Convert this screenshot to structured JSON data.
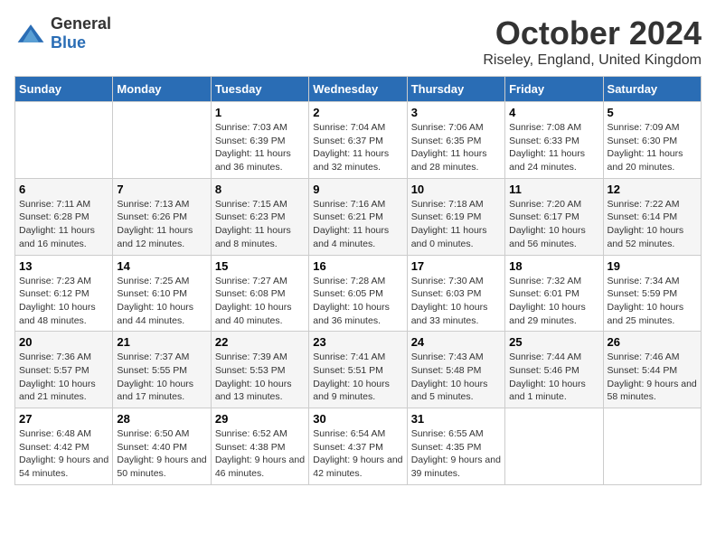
{
  "header": {
    "logo": {
      "general": "General",
      "blue": "Blue"
    },
    "month_title": "October 2024",
    "location": "Riseley, England, United Kingdom"
  },
  "weekdays": [
    "Sunday",
    "Monday",
    "Tuesday",
    "Wednesday",
    "Thursday",
    "Friday",
    "Saturday"
  ],
  "weeks": [
    [
      {
        "day": "",
        "sunrise": "",
        "sunset": "",
        "daylight": ""
      },
      {
        "day": "",
        "sunrise": "",
        "sunset": "",
        "daylight": ""
      },
      {
        "day": "1",
        "sunrise": "Sunrise: 7:03 AM",
        "sunset": "Sunset: 6:39 PM",
        "daylight": "Daylight: 11 hours and 36 minutes."
      },
      {
        "day": "2",
        "sunrise": "Sunrise: 7:04 AM",
        "sunset": "Sunset: 6:37 PM",
        "daylight": "Daylight: 11 hours and 32 minutes."
      },
      {
        "day": "3",
        "sunrise": "Sunrise: 7:06 AM",
        "sunset": "Sunset: 6:35 PM",
        "daylight": "Daylight: 11 hours and 28 minutes."
      },
      {
        "day": "4",
        "sunrise": "Sunrise: 7:08 AM",
        "sunset": "Sunset: 6:33 PM",
        "daylight": "Daylight: 11 hours and 24 minutes."
      },
      {
        "day": "5",
        "sunrise": "Sunrise: 7:09 AM",
        "sunset": "Sunset: 6:30 PM",
        "daylight": "Daylight: 11 hours and 20 minutes."
      }
    ],
    [
      {
        "day": "6",
        "sunrise": "Sunrise: 7:11 AM",
        "sunset": "Sunset: 6:28 PM",
        "daylight": "Daylight: 11 hours and 16 minutes."
      },
      {
        "day": "7",
        "sunrise": "Sunrise: 7:13 AM",
        "sunset": "Sunset: 6:26 PM",
        "daylight": "Daylight: 11 hours and 12 minutes."
      },
      {
        "day": "8",
        "sunrise": "Sunrise: 7:15 AM",
        "sunset": "Sunset: 6:23 PM",
        "daylight": "Daylight: 11 hours and 8 minutes."
      },
      {
        "day": "9",
        "sunrise": "Sunrise: 7:16 AM",
        "sunset": "Sunset: 6:21 PM",
        "daylight": "Daylight: 11 hours and 4 minutes."
      },
      {
        "day": "10",
        "sunrise": "Sunrise: 7:18 AM",
        "sunset": "Sunset: 6:19 PM",
        "daylight": "Daylight: 11 hours and 0 minutes."
      },
      {
        "day": "11",
        "sunrise": "Sunrise: 7:20 AM",
        "sunset": "Sunset: 6:17 PM",
        "daylight": "Daylight: 10 hours and 56 minutes."
      },
      {
        "day": "12",
        "sunrise": "Sunrise: 7:22 AM",
        "sunset": "Sunset: 6:14 PM",
        "daylight": "Daylight: 10 hours and 52 minutes."
      }
    ],
    [
      {
        "day": "13",
        "sunrise": "Sunrise: 7:23 AM",
        "sunset": "Sunset: 6:12 PM",
        "daylight": "Daylight: 10 hours and 48 minutes."
      },
      {
        "day": "14",
        "sunrise": "Sunrise: 7:25 AM",
        "sunset": "Sunset: 6:10 PM",
        "daylight": "Daylight: 10 hours and 44 minutes."
      },
      {
        "day": "15",
        "sunrise": "Sunrise: 7:27 AM",
        "sunset": "Sunset: 6:08 PM",
        "daylight": "Daylight: 10 hours and 40 minutes."
      },
      {
        "day": "16",
        "sunrise": "Sunrise: 7:28 AM",
        "sunset": "Sunset: 6:05 PM",
        "daylight": "Daylight: 10 hours and 36 minutes."
      },
      {
        "day": "17",
        "sunrise": "Sunrise: 7:30 AM",
        "sunset": "Sunset: 6:03 PM",
        "daylight": "Daylight: 10 hours and 33 minutes."
      },
      {
        "day": "18",
        "sunrise": "Sunrise: 7:32 AM",
        "sunset": "Sunset: 6:01 PM",
        "daylight": "Daylight: 10 hours and 29 minutes."
      },
      {
        "day": "19",
        "sunrise": "Sunrise: 7:34 AM",
        "sunset": "Sunset: 5:59 PM",
        "daylight": "Daylight: 10 hours and 25 minutes."
      }
    ],
    [
      {
        "day": "20",
        "sunrise": "Sunrise: 7:36 AM",
        "sunset": "Sunset: 5:57 PM",
        "daylight": "Daylight: 10 hours and 21 minutes."
      },
      {
        "day": "21",
        "sunrise": "Sunrise: 7:37 AM",
        "sunset": "Sunset: 5:55 PM",
        "daylight": "Daylight: 10 hours and 17 minutes."
      },
      {
        "day": "22",
        "sunrise": "Sunrise: 7:39 AM",
        "sunset": "Sunset: 5:53 PM",
        "daylight": "Daylight: 10 hours and 13 minutes."
      },
      {
        "day": "23",
        "sunrise": "Sunrise: 7:41 AM",
        "sunset": "Sunset: 5:51 PM",
        "daylight": "Daylight: 10 hours and 9 minutes."
      },
      {
        "day": "24",
        "sunrise": "Sunrise: 7:43 AM",
        "sunset": "Sunset: 5:48 PM",
        "daylight": "Daylight: 10 hours and 5 minutes."
      },
      {
        "day": "25",
        "sunrise": "Sunrise: 7:44 AM",
        "sunset": "Sunset: 5:46 PM",
        "daylight": "Daylight: 10 hours and 1 minute."
      },
      {
        "day": "26",
        "sunrise": "Sunrise: 7:46 AM",
        "sunset": "Sunset: 5:44 PM",
        "daylight": "Daylight: 9 hours and 58 minutes."
      }
    ],
    [
      {
        "day": "27",
        "sunrise": "Sunrise: 6:48 AM",
        "sunset": "Sunset: 4:42 PM",
        "daylight": "Daylight: 9 hours and 54 minutes."
      },
      {
        "day": "28",
        "sunrise": "Sunrise: 6:50 AM",
        "sunset": "Sunset: 4:40 PM",
        "daylight": "Daylight: 9 hours and 50 minutes."
      },
      {
        "day": "29",
        "sunrise": "Sunrise: 6:52 AM",
        "sunset": "Sunset: 4:38 PM",
        "daylight": "Daylight: 9 hours and 46 minutes."
      },
      {
        "day": "30",
        "sunrise": "Sunrise: 6:54 AM",
        "sunset": "Sunset: 4:37 PM",
        "daylight": "Daylight: 9 hours and 42 minutes."
      },
      {
        "day": "31",
        "sunrise": "Sunrise: 6:55 AM",
        "sunset": "Sunset: 4:35 PM",
        "daylight": "Daylight: 9 hours and 39 minutes."
      },
      {
        "day": "",
        "sunrise": "",
        "sunset": "",
        "daylight": ""
      },
      {
        "day": "",
        "sunrise": "",
        "sunset": "",
        "daylight": ""
      }
    ]
  ]
}
